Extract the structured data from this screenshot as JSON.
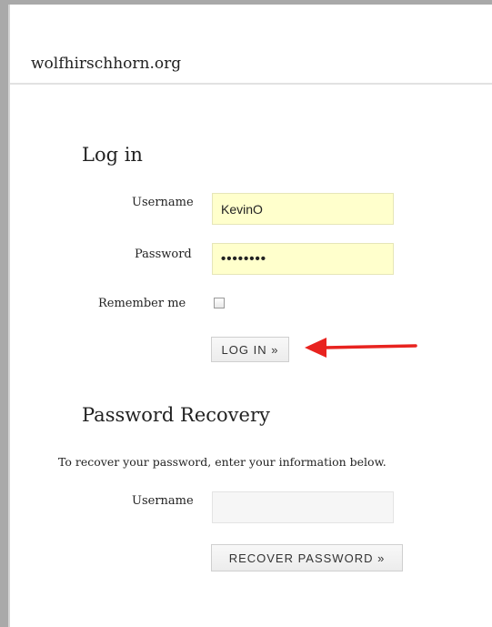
{
  "site": {
    "title": "wolfhirschhorn.org"
  },
  "login": {
    "heading": "Log in",
    "username_label": "Username",
    "username_value": "KevinO",
    "password_label": "Password",
    "password_value": "••••••••",
    "remember_label": "Remember me",
    "remember_checked": false,
    "submit_label": "LOG IN »"
  },
  "recovery": {
    "heading": "Password Recovery",
    "description": "To recover your password, enter your information below.",
    "username_label": "Username",
    "username_value": "",
    "submit_label": "RECOVER PASSWORD »"
  },
  "annotation": {
    "arrow_icon": "red-arrow-left-icon",
    "arrow_color": "#e8231f"
  },
  "colors": {
    "input_fill": "#ffffcc",
    "empty_input_fill": "#f6f6f6",
    "border": "#a9a9a9"
  }
}
